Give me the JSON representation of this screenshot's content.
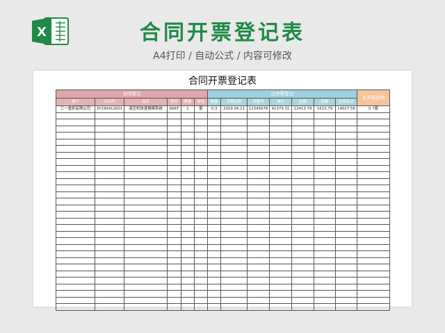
{
  "logo": {
    "letter": "X"
  },
  "page": {
    "title": "合同开票登记表",
    "subtitle": "A4打印 / 自动公式 / 内容可修改"
  },
  "sheet": {
    "title": "合同开票登记表",
    "groups": [
      "合同登记",
      "已开票登记",
      "未开票说明"
    ],
    "headers": [
      "客户",
      "合同号",
      "品名",
      "型号",
      "数量",
      "单位",
      "数量",
      "开票日期",
      "发票号",
      "单价",
      "金额",
      "税额",
      "价税合计",
      ""
    ],
    "first_row": [
      "三一重机有限公司",
      "3Y190412001",
      "液压机快速换模系统",
      "666T",
      "1",
      "套",
      "0.3",
      "2019.04.11",
      "12345678",
      "41379.31",
      "12413.79",
      "1613.79",
      "14027.58",
      "0.7套"
    ],
    "empty_rows": 30
  },
  "colors": {
    "title": "#1f8a47",
    "contract": "#dfa7ab",
    "invoiced": "#9fd0dd",
    "pending": "#f5c49a"
  }
}
